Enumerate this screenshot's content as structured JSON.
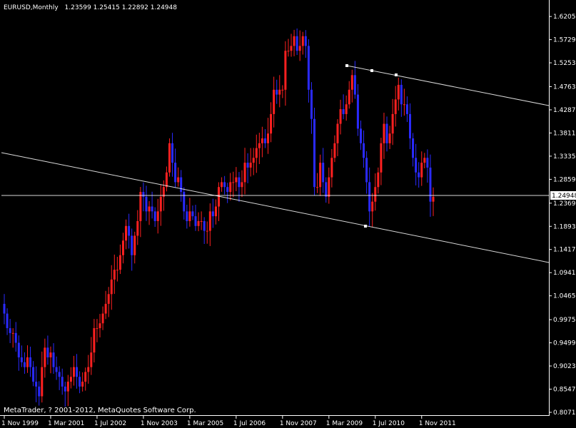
{
  "header": {
    "symbol": "EURUSD,Monthly",
    "ohlc": "1.23599 1.25415 1.22892 1.24948"
  },
  "footer": {
    "copyright": "MetaTrader, ? 2001-2012, MetaQuotes Software Corp."
  },
  "colors": {
    "background": "#000000",
    "bull": "#ff2020",
    "bear": "#2a2aff",
    "line": "#ffffff",
    "axis": "#ffffff"
  },
  "chart_data": {
    "type": "candlestick",
    "title": "",
    "ylim": [
      0.8071,
      1.628
    ],
    "y_ticks": [
      "1.62050",
      "1.57290",
      "1.52530",
      "1.47630",
      "1.42870",
      "1.38110",
      "1.33350",
      "1.28590",
      "1.23690",
      "1.18930",
      "1.14170",
      "1.09410",
      "1.04650",
      "0.99750",
      "0.94990",
      "0.90230",
      "0.85470",
      "0.80710"
    ],
    "current_price": "1.24948",
    "x_ticks": [
      "1 Nov 1999",
      "1 Mar 2001",
      "1 Jul 2002",
      "1 Nov 2003",
      "1 Mar 2005",
      "1 Jul 2006",
      "1 Nov 2007",
      "1 Mar 2009",
      "1 Jul 2010",
      "1 Nov 2011"
    ],
    "x_tick_index": [
      0,
      16,
      32,
      48,
      64,
      80,
      96,
      112,
      128,
      144
    ],
    "start_month": "Nov 1999",
    "closes": [
      1.01,
      0.98,
      0.97,
      0.97,
      0.95,
      0.92,
      0.91,
      0.9,
      0.92,
      0.9,
      0.87,
      0.86,
      0.84,
      0.9,
      0.94,
      0.92,
      0.93,
      0.9,
      0.89,
      0.88,
      0.86,
      0.85,
      0.87,
      0.88,
      0.9,
      0.88,
      0.86,
      0.87,
      0.89,
      0.9,
      0.93,
      0.98,
      0.98,
      0.99,
      1.01,
      1.03,
      1.05,
      1.08,
      1.1,
      1.1,
      1.13,
      1.16,
      1.19,
      1.17,
      1.13,
      1.17,
      1.2,
      1.26,
      1.25,
      1.22,
      1.23,
      1.22,
      1.2,
      1.22,
      1.25,
      1.27,
      1.3,
      1.36,
      1.32,
      1.28,
      1.29,
      1.26,
      1.22,
      1.2,
      1.22,
      1.21,
      1.19,
      1.2,
      1.2,
      1.18,
      1.18,
      1.22,
      1.21,
      1.23,
      1.27,
      1.28,
      1.27,
      1.26,
      1.28,
      1.28,
      1.29,
      1.27,
      1.28,
      1.32,
      1.31,
      1.32,
      1.33,
      1.35,
      1.36,
      1.37,
      1.36,
      1.38,
      1.42,
      1.47,
      1.46,
      1.47,
      1.47,
      1.55,
      1.55,
      1.56,
      1.58,
      1.55,
      1.56,
      1.58,
      1.56,
      1.47,
      1.41,
      1.27,
      1.27,
      1.32,
      1.28,
      1.25,
      1.29,
      1.33,
      1.36,
      1.4,
      1.43,
      1.42,
      1.44,
      1.47,
      1.5,
      1.46,
      1.39,
      1.36,
      1.33,
      1.28,
      1.22,
      1.24,
      1.27,
      1.3,
      1.36,
      1.4,
      1.36,
      1.38,
      1.42,
      1.45,
      1.48,
      1.44,
      1.44,
      1.42,
      1.37,
      1.33,
      1.3,
      1.29,
      1.32,
      1.33,
      1.31,
      1.24,
      1.25
    ]
  }
}
